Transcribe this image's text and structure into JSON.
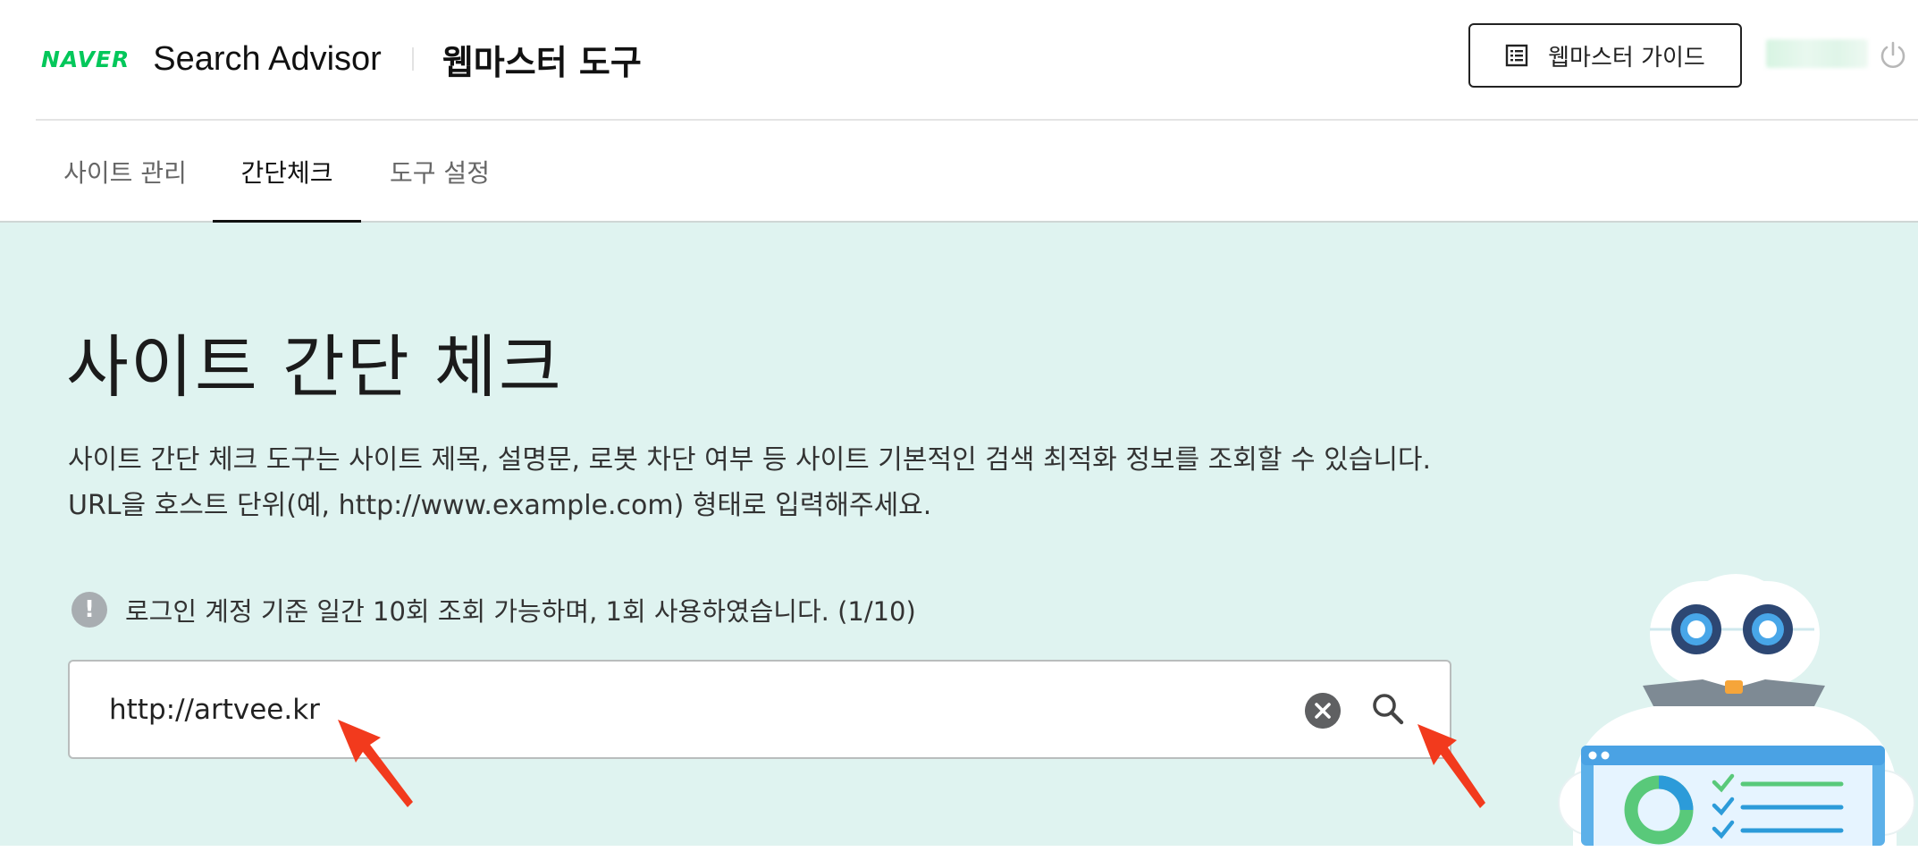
{
  "header": {
    "logo_text": "NAVER",
    "product_name": "Search Advisor",
    "tool_name": "웹마스터 도구",
    "guide_button_label": "웹마스터 가이드",
    "guide_icon": "list-document-icon",
    "power_icon": "power-icon"
  },
  "tabs": [
    {
      "label": "사이트 관리",
      "active": false
    },
    {
      "label": "간단체크",
      "active": true
    },
    {
      "label": "도구 설정",
      "active": false
    }
  ],
  "main": {
    "title": "사이트 간단 체크",
    "description_line1": "사이트 간단 체크 도구는 사이트 제목, 설명문, 로봇 차단 여부 등 사이트 기본적인 검색 최적화 정보를 조회할 수 있습니다.",
    "description_line2": "URL을 호스트 단위(예, http://www.example.com) 형태로 입력해주세요.",
    "notice_icon_glyph": "!",
    "notice_text": "로그인 계정 기준 일간 10회 조회 가능하며, 1회 사용하였습니다. (1/10)",
    "search": {
      "value": "http://artvee.kr",
      "clear_icon": "clear-icon",
      "search_icon": "search-icon"
    }
  },
  "colors": {
    "brand_green": "#03c75a",
    "panel_background": "#dff3f0",
    "annotation_red": "#f23a1d"
  }
}
